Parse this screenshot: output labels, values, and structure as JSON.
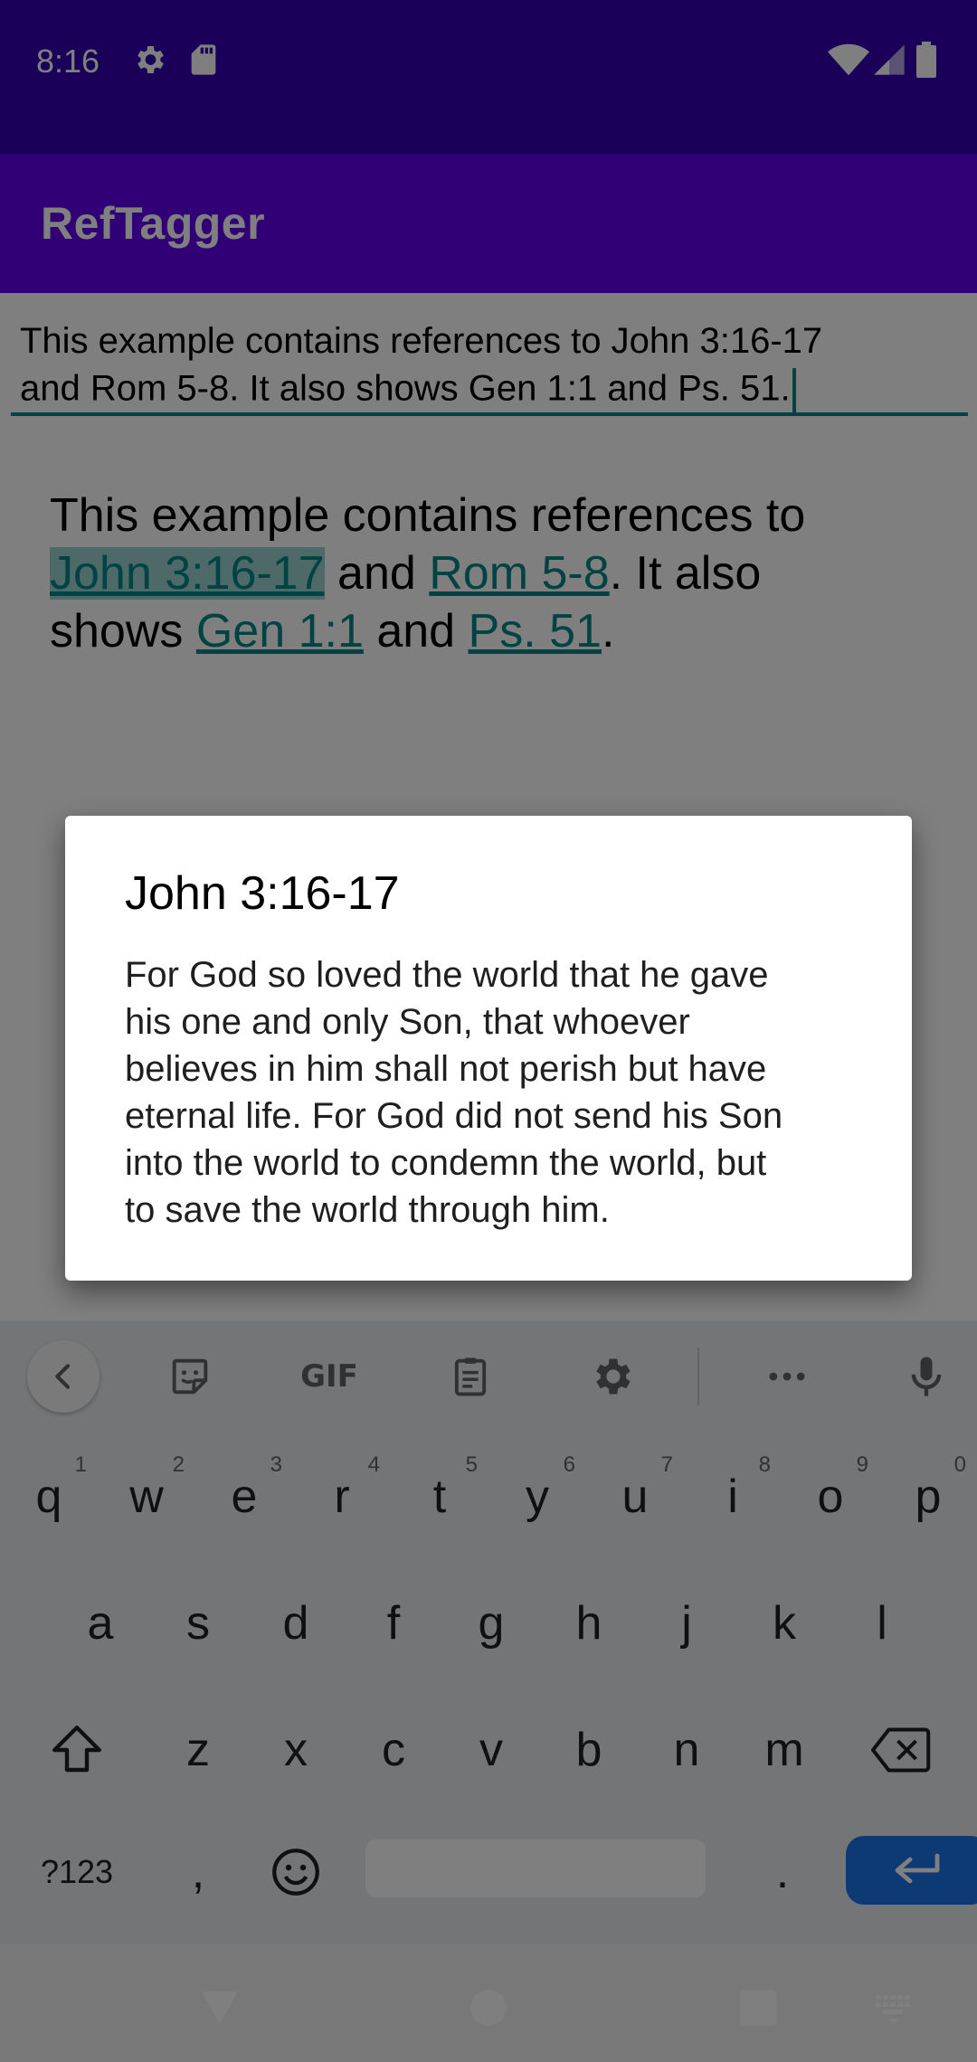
{
  "status_bar": {
    "time": "8:16",
    "icons": [
      "settings-icon",
      "sd-card-icon",
      "wifi-icon",
      "signal-icon",
      "battery-icon"
    ]
  },
  "app_bar": {
    "title": "RefTagger"
  },
  "edit_field": {
    "lines": [
      "This example contains references to John 3:16-17",
      "and Rom 5-8. It also shows Gen 1:1 and Ps. 51."
    ]
  },
  "rich_text": {
    "l1": "This example contains references to",
    "ref1": "John 3:16-17",
    "t_and1": " and ",
    "ref2": "Rom 5-8",
    "t_also": ". It also",
    "t_shows": "shows ",
    "ref3": "Gen 1:1",
    "t_and2": " and ",
    "ref4": "Ps. 51",
    "t_end": "."
  },
  "dialog": {
    "title": "John 3:16-17",
    "body_lines": [
      "For God so loved the world that he gave",
      "his one and only Son, that whoever",
      "believes in him shall not perish but have",
      "eternal life. For God did not send his Son",
      "into the world to condemn the world, but",
      "to save the world through him."
    ]
  },
  "keyboard": {
    "toolbar": [
      "back-icon",
      "sticker-icon",
      "GIF",
      "clipboard-icon",
      "gear-icon",
      "more-icon",
      "mic-icon"
    ],
    "row1": [
      {
        "k": "q",
        "h": "1"
      },
      {
        "k": "w",
        "h": "2"
      },
      {
        "k": "e",
        "h": "3"
      },
      {
        "k": "r",
        "h": "4"
      },
      {
        "k": "t",
        "h": "5"
      },
      {
        "k": "y",
        "h": "6"
      },
      {
        "k": "u",
        "h": "7"
      },
      {
        "k": "i",
        "h": "8"
      },
      {
        "k": "o",
        "h": "9"
      },
      {
        "k": "p",
        "h": "0"
      }
    ],
    "row2": [
      "a",
      "s",
      "d",
      "f",
      "g",
      "h",
      "j",
      "k",
      "l"
    ],
    "row3": [
      "z",
      "x",
      "c",
      "v",
      "b",
      "n",
      "m"
    ],
    "sym_label": "?123",
    "comma": ",",
    "period": "."
  },
  "nav_bar": {
    "icons": [
      "back-triangle-icon",
      "home-circle-icon",
      "recents-square-icon",
      "keyboard-switch-icon"
    ]
  }
}
